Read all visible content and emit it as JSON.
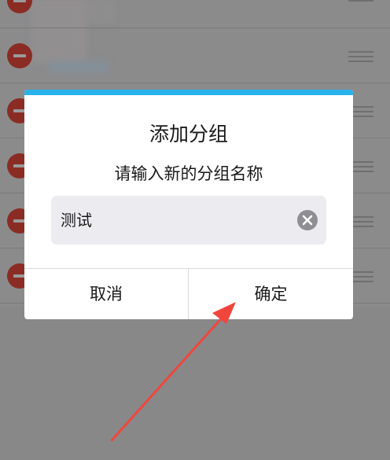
{
  "dialog": {
    "title": "添加分组",
    "message": "请输入新的分组名称",
    "input_value": "测试",
    "cancel_label": "取消",
    "confirm_label": "确定",
    "accent_color": "#2ab2ea"
  },
  "background_list": {
    "rows": 6,
    "remove_icon": "remove-circle-icon",
    "drag_icon": "drag-handle-icon"
  },
  "annotation": {
    "arrow_color": "#f0463c",
    "target": "confirm-button"
  }
}
